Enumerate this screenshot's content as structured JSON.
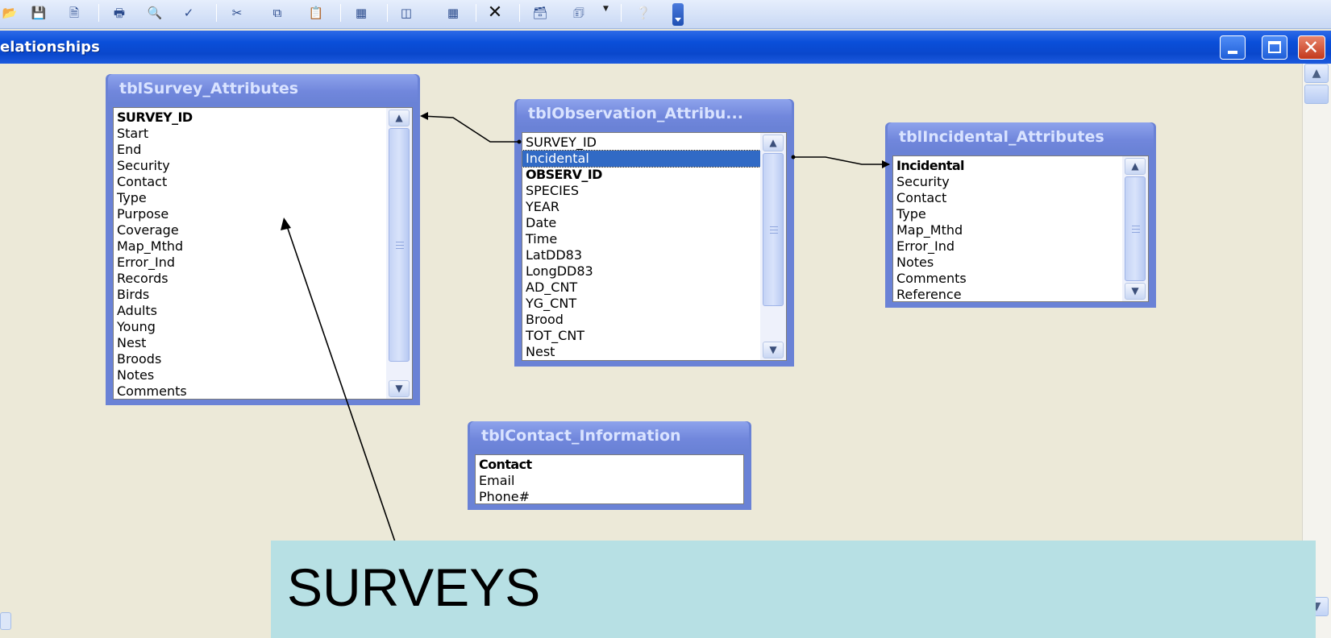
{
  "window": {
    "title": "elationships",
    "minimize_label": "",
    "close_label": "✕"
  },
  "toolbar": {
    "icons": [
      "open-icon",
      "save-icon",
      "save-as-web-icon",
      "print-icon",
      "print-preview-icon",
      "spelling-icon",
      "cut-icon",
      "copy-icon",
      "paste-icon",
      "show-table-icon",
      "show-direct-icon",
      "show-all-icon",
      "delete-icon",
      "new-object-icon",
      "new-object-dropdown-icon",
      "help-icon",
      "toolbar-options-icon"
    ]
  },
  "tables": [
    {
      "name": "tblSurvey_Attributes",
      "fields": [
        {
          "label": "SURVEY_ID",
          "key": true
        },
        {
          "label": "Start"
        },
        {
          "label": "End"
        },
        {
          "label": "Security"
        },
        {
          "label": "Contact"
        },
        {
          "label": "Type"
        },
        {
          "label": "Purpose"
        },
        {
          "label": "Coverage"
        },
        {
          "label": "Map_Mthd"
        },
        {
          "label": "Error_Ind"
        },
        {
          "label": "Records"
        },
        {
          "label": "Birds"
        },
        {
          "label": "Adults"
        },
        {
          "label": "Young"
        },
        {
          "label": "Nest"
        },
        {
          "label": "Broods"
        },
        {
          "label": "Notes"
        },
        {
          "label": "Comments"
        }
      ]
    },
    {
      "name": "tblObservation_Attribu...",
      "fields": [
        {
          "label": "SURVEY_ID"
        },
        {
          "label": "Incidental",
          "selected": true
        },
        {
          "label": "OBSERV_ID",
          "key": true
        },
        {
          "label": "SPECIES"
        },
        {
          "label": "YEAR"
        },
        {
          "label": "Date"
        },
        {
          "label": "Time"
        },
        {
          "label": "LatDD83"
        },
        {
          "label": "LongDD83"
        },
        {
          "label": "AD_CNT"
        },
        {
          "label": "YG_CNT"
        },
        {
          "label": "Brood"
        },
        {
          "label": "TOT_CNT"
        },
        {
          "label": "Nest"
        }
      ]
    },
    {
      "name": "tblIncidental_Attributes",
      "fields": [
        {
          "label": "Incidental",
          "key": true
        },
        {
          "label": "Security"
        },
        {
          "label": "Contact"
        },
        {
          "label": "Type"
        },
        {
          "label": "Map_Mthd"
        },
        {
          "label": "Error_Ind"
        },
        {
          "label": "Notes"
        },
        {
          "label": "Comments"
        },
        {
          "label": "Reference"
        }
      ]
    },
    {
      "name": "tblContact_Information",
      "fields": [
        {
          "label": "Contact",
          "key": true
        },
        {
          "label": "Email"
        },
        {
          "label": "Phone#"
        }
      ]
    }
  ],
  "relationships": [
    {
      "from": "tblObservation_Attribu....SURVEY_ID",
      "to": "tblSurvey_Attributes.SURVEY_ID"
    },
    {
      "from": "tblObservation_Attribu....Incidental",
      "to": "tblIncidental_Attributes.Incidental"
    }
  ],
  "callout": {
    "text": "SURVEYS",
    "color": "#b7e0e4"
  },
  "colors": {
    "titlebar": "#0a4fd9",
    "fieldlist_frame": "#6a82d6",
    "selection": "#316ac5",
    "canvas": "#ece9d8"
  }
}
